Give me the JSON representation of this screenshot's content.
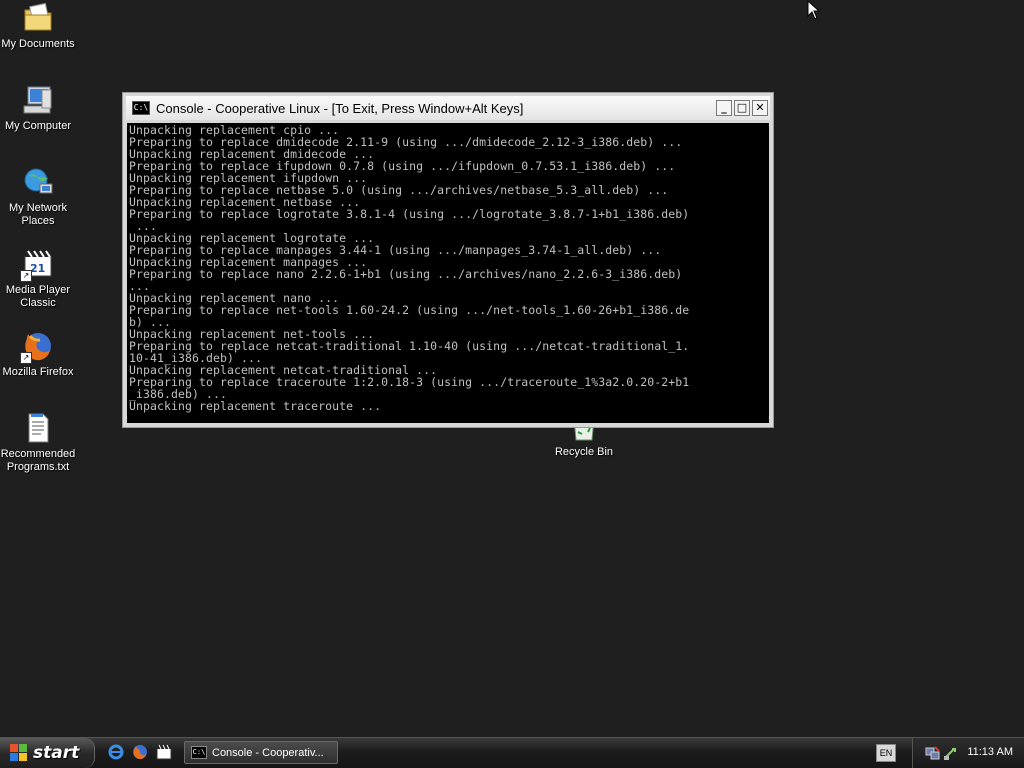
{
  "desktop": {
    "icons": [
      {
        "label": "My Documents",
        "icon": "my-documents-icon"
      },
      {
        "label": "My Computer",
        "icon": "my-computer-icon"
      },
      {
        "label": "My Network Places",
        "icon": "network-places-icon"
      },
      {
        "label": "Media Player Classic",
        "icon": "media-player-icon"
      },
      {
        "label": "Mozilla Firefox",
        "icon": "firefox-icon"
      },
      {
        "label": "Recommended Programs.txt",
        "icon": "text-file-icon"
      },
      {
        "label": "Recycle Bin",
        "icon": "recycle-bin-icon"
      }
    ]
  },
  "window": {
    "title": "Console - Cooperative Linux - [To Exit, Press Window+Alt Keys]",
    "icon_text": "C:\\",
    "buttons": {
      "minimize": "_",
      "maximize": "□",
      "close": "✕"
    },
    "console_text": "Unpacking replacement cpio ...\nPreparing to replace dmidecode 2.11-9 (using .../dmidecode_2.12-3_i386.deb) ...\nUnpacking replacement dmidecode ...\nPreparing to replace ifupdown 0.7.8 (using .../ifupdown_0.7.53.1_i386.deb) ...\nUnpacking replacement ifupdown ...\nPreparing to replace netbase 5.0 (using .../archives/netbase_5.3_all.deb) ...\nUnpacking replacement netbase ...\nPreparing to replace logrotate 3.8.1-4 (using .../logrotate_3.8.7-1+b1_i386.deb)\n ...\nUnpacking replacement logrotate ...\nPreparing to replace manpages 3.44-1 (using .../manpages_3.74-1_all.deb) ...\nUnpacking replacement manpages ...\nPreparing to replace nano 2.2.6-1+b1 (using .../archives/nano_2.2.6-3_i386.deb)\n...\nUnpacking replacement nano ...\nPreparing to replace net-tools 1.60-24.2 (using .../net-tools_1.60-26+b1_i386.de\nb) ...\nUnpacking replacement net-tools ...\nPreparing to replace netcat-traditional 1.10-40 (using .../netcat-traditional_1.\n10-41_i386.deb) ...\nUnpacking replacement netcat-traditional ...\nPreparing to replace traceroute 1:2.0.18-3 (using .../traceroute_1%3a2.0.20-2+b1\n_i386.deb) ...\nUnpacking replacement traceroute ..."
  },
  "taskbar": {
    "start_label": "start",
    "quicklaunch": [
      "internet-explorer-icon",
      "firefox-icon",
      "media-player-icon"
    ],
    "task_button_label": "Console - Cooperativ...",
    "language": "EN",
    "clock": "11:13 AM"
  }
}
